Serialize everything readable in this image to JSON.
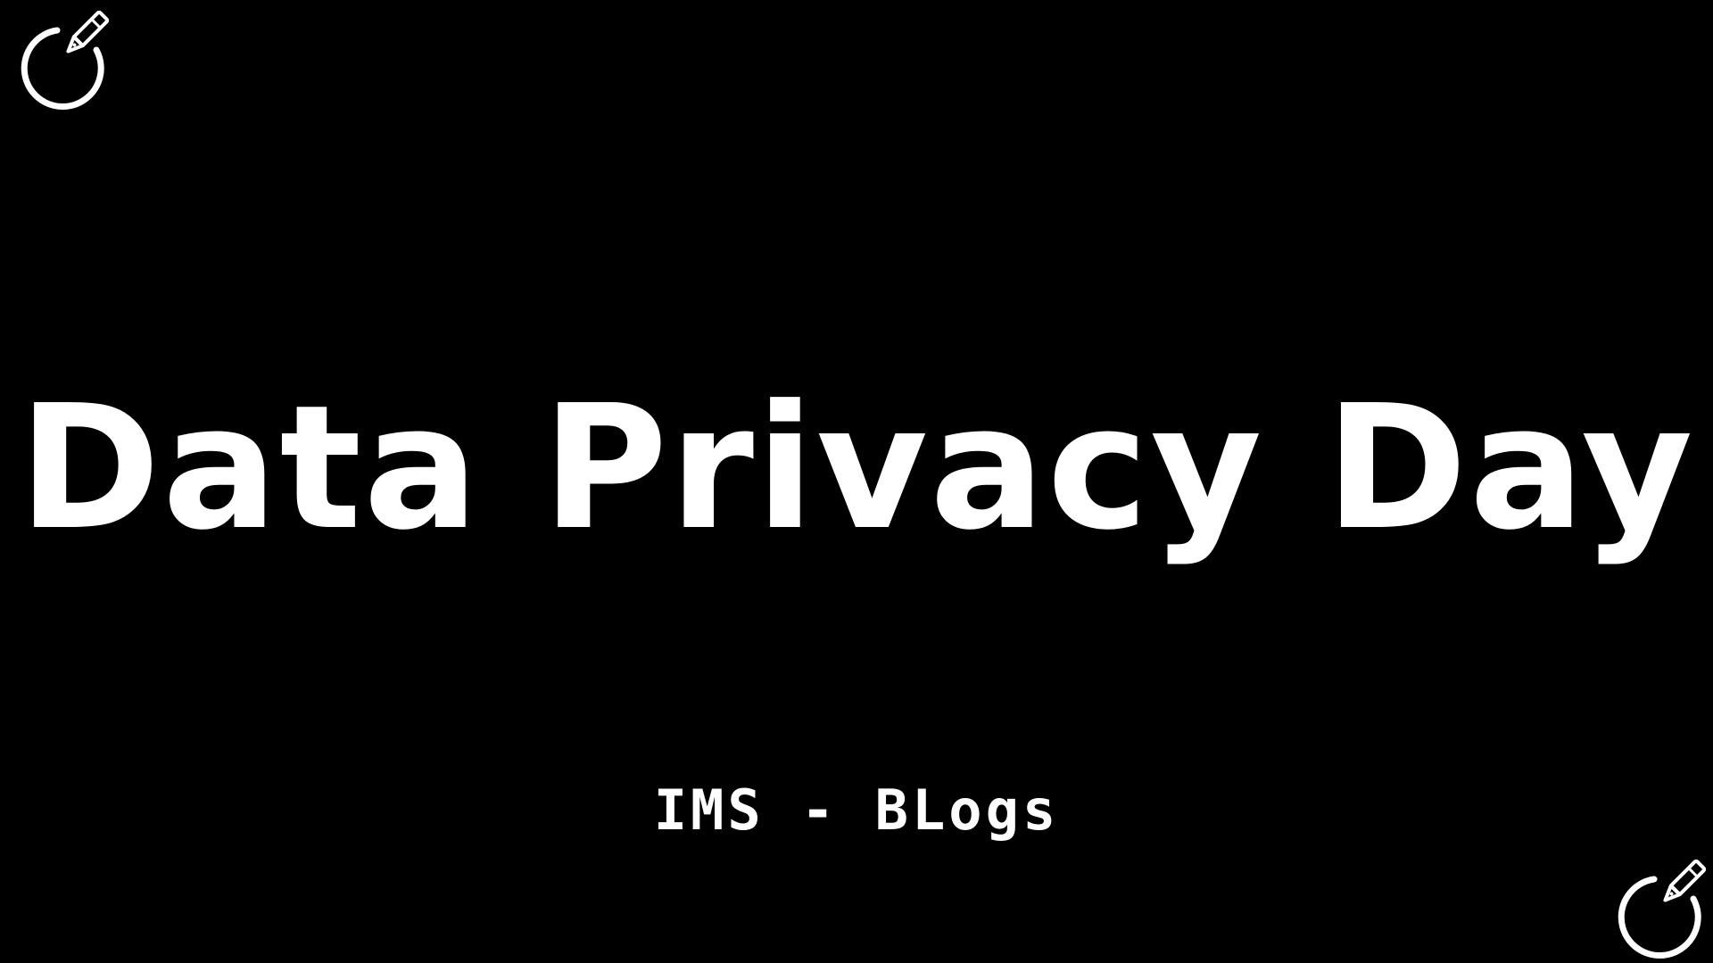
{
  "slide": {
    "title": "Data Privacy Day",
    "subtitle": "IMS - BLogs"
  },
  "icons": {
    "top_left": "refresh-pen-logo-icon",
    "bottom_right": "refresh-pen-logo-icon"
  },
  "colors": {
    "background": "#000000",
    "foreground": "#ffffff"
  }
}
